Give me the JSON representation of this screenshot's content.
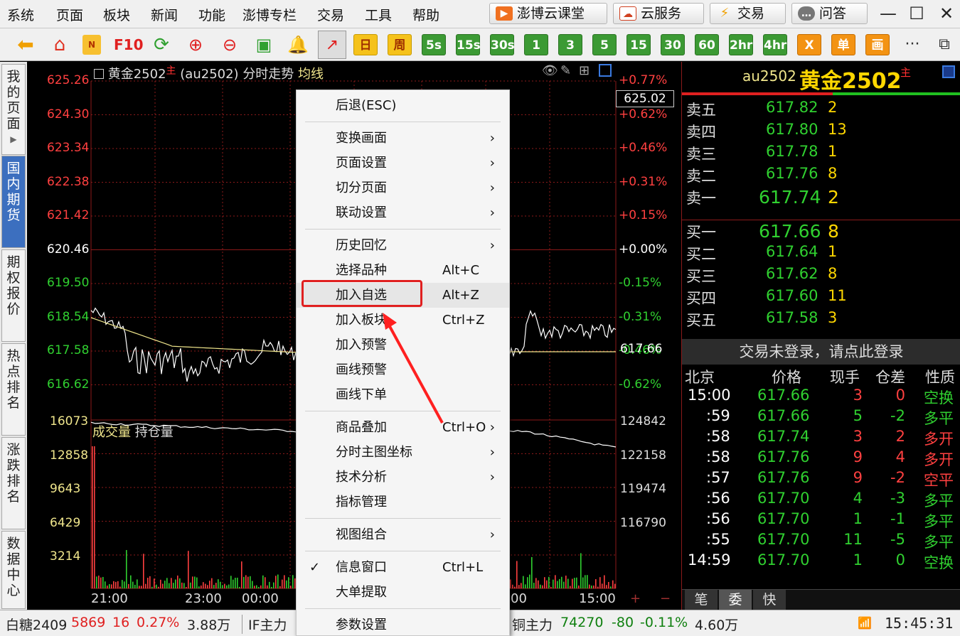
{
  "menubar": {
    "items": [
      "系统",
      "页面",
      "板块",
      "新闻",
      "功能",
      "澎博专栏",
      "交易",
      "工具",
      "帮助"
    ],
    "buttons": [
      {
        "label": "澎博云课堂",
        "icon": "classroom-icon",
        "color": "#f07020"
      },
      {
        "label": "云服务",
        "icon": "cloud-icon",
        "color": "#d04020"
      },
      {
        "label": "交易",
        "icon": "lightning-icon",
        "color": "#f0a000"
      },
      {
        "label": "问答",
        "icon": "chat-icon",
        "color": "#808080"
      }
    ]
  },
  "toolbar": {
    "periods": [
      {
        "label": "日",
        "style": "yellow"
      },
      {
        "label": "周",
        "style": "yellow"
      },
      {
        "label": "5s",
        "style": "green"
      },
      {
        "label": "15s",
        "style": "green"
      },
      {
        "label": "30s",
        "style": "green"
      },
      {
        "label": "1",
        "style": "green"
      },
      {
        "label": "3",
        "style": "green"
      },
      {
        "label": "5",
        "style": "green"
      },
      {
        "label": "15",
        "style": "green"
      },
      {
        "label": "30",
        "style": "green"
      },
      {
        "label": "60",
        "style": "green"
      },
      {
        "label": "2hr",
        "style": "green"
      },
      {
        "label": "4hr",
        "style": "green"
      },
      {
        "label": "X",
        "style": "orange"
      },
      {
        "label": "单",
        "style": "orange"
      },
      {
        "label": "画",
        "style": "orange"
      }
    ],
    "f10_label": "F10",
    "more_label": "···"
  },
  "sidebar": {
    "tabs": [
      {
        "label": "我的页面",
        "active": false
      },
      {
        "label": "国内期货",
        "active": true
      },
      {
        "label": "期权报价",
        "active": false
      },
      {
        "label": "热点排名",
        "active": false
      },
      {
        "label": "涨跌排名",
        "active": false
      },
      {
        "label": "数据中心",
        "active": false
      }
    ]
  },
  "chart": {
    "title_name": "黄金2502",
    "title_badge": "主",
    "title_code": "(au2502)",
    "title_mode": "分时走势",
    "title_avg": "均线",
    "price_labels": [
      "625.26",
      "624.30",
      "623.34",
      "622.38",
      "621.42",
      "620.46",
      "619.50",
      "618.54",
      "617.58",
      "616.62"
    ],
    "pct_labels": [
      "+0.77%",
      "+0.62%",
      "+0.46%",
      "+0.31%",
      "+0.15%",
      "+0.00%",
      "-0.15%",
      "-0.31%",
      "-0.46%",
      "-0.62%"
    ],
    "current_price_tag": "625.02",
    "last_price_tag": "617.66",
    "volume_labels": [
      "16073",
      "12858",
      "9643",
      "6429",
      "3214"
    ],
    "oi_labels": [
      "124842",
      "122158",
      "119474",
      "116790"
    ],
    "volume_legend_vol": "成交量",
    "volume_legend_oi": "持仓量",
    "time_labels": [
      "21:00",
      "23:00",
      "00:00",
      "00",
      "15:00"
    ],
    "plus": "+",
    "minus": "−",
    "colors": {
      "up": "#ff4040",
      "down": "#30d030",
      "flat": "#ffffff",
      "grid": "#8b1a1a",
      "avg": "#f0e68c"
    }
  },
  "quote": {
    "code": "au2502",
    "name": "黄金2502",
    "badge": "主",
    "asks": [
      {
        "label": "卖五",
        "price": "617.82",
        "vol": "2"
      },
      {
        "label": "卖四",
        "price": "617.80",
        "vol": "13"
      },
      {
        "label": "卖三",
        "price": "617.78",
        "vol": "1"
      },
      {
        "label": "卖二",
        "price": "617.76",
        "vol": "8"
      },
      {
        "label": "卖一",
        "price": "617.74",
        "vol": "2"
      }
    ],
    "bids": [
      {
        "label": "买一",
        "price": "617.66",
        "vol": "8"
      },
      {
        "label": "买二",
        "price": "617.64",
        "vol": "1"
      },
      {
        "label": "买三",
        "price": "617.62",
        "vol": "8"
      },
      {
        "label": "买四",
        "price": "617.60",
        "vol": "11"
      },
      {
        "label": "买五",
        "price": "617.58",
        "vol": "3"
      }
    ],
    "login_banner": "交易未登录，请点此登录",
    "tick_headers": [
      "北京",
      "价格",
      "现手",
      "仓差",
      "性质"
    ],
    "ticks": [
      {
        "time": "15:00",
        "price": "617.66",
        "hand": "3",
        "diff": "0",
        "nature": "空换",
        "hc": "up",
        "nc": "down"
      },
      {
        "time": ":59",
        "price": "617.66",
        "hand": "5",
        "diff": "-2",
        "nature": "多平",
        "hc": "down",
        "nc": "down"
      },
      {
        "time": ":58",
        "price": "617.74",
        "hand": "3",
        "diff": "2",
        "nature": "多开",
        "hc": "up",
        "nc": "up"
      },
      {
        "time": ":58",
        "price": "617.76",
        "hand": "9",
        "diff": "4",
        "nature": "多开",
        "hc": "up",
        "nc": "up"
      },
      {
        "time": ":57",
        "price": "617.76",
        "hand": "9",
        "diff": "-2",
        "nature": "空平",
        "hc": "up",
        "nc": "up"
      },
      {
        "time": ":56",
        "price": "617.70",
        "hand": "4",
        "diff": "-3",
        "nature": "多平",
        "hc": "down",
        "nc": "down"
      },
      {
        "time": ":56",
        "price": "617.70",
        "hand": "1",
        "diff": "-1",
        "nature": "多平",
        "hc": "down",
        "nc": "down"
      },
      {
        "time": ":55",
        "price": "617.70",
        "hand": "11",
        "diff": "-5",
        "nature": "多平",
        "hc": "down",
        "nc": "down"
      },
      {
        "time": "14:59",
        "price": "617.70",
        "hand": "1",
        "diff": "0",
        "nature": "空换",
        "hc": "down",
        "nc": "down"
      }
    ],
    "bottom_tabs": [
      "笔",
      "委",
      "快"
    ]
  },
  "context_menu": {
    "items": [
      {
        "label": "后退(ESC)",
        "shortcut": "",
        "submenu": false
      },
      {
        "sep": true
      },
      {
        "label": "变换画面",
        "shortcut": "",
        "submenu": true
      },
      {
        "label": "页面设置",
        "shortcut": "",
        "submenu": true
      },
      {
        "label": "切分页面",
        "shortcut": "",
        "submenu": true
      },
      {
        "label": "联动设置",
        "shortcut": "",
        "submenu": true
      },
      {
        "sep": true
      },
      {
        "label": "历史回忆",
        "shortcut": "",
        "submenu": true
      },
      {
        "label": "选择品种",
        "shortcut": "Alt+C",
        "submenu": false
      },
      {
        "label": "加入自选",
        "shortcut": "Alt+Z",
        "submenu": false,
        "highlight": true
      },
      {
        "label": "加入板块",
        "shortcut": "Ctrl+Z",
        "submenu": false
      },
      {
        "label": "加入预警",
        "shortcut": "",
        "submenu": false
      },
      {
        "label": "画线预警",
        "shortcut": "",
        "submenu": false
      },
      {
        "label": "画线下单",
        "shortcut": "",
        "submenu": false
      },
      {
        "sep": true
      },
      {
        "label": "商品叠加",
        "shortcut": "Ctrl+O",
        "submenu": true
      },
      {
        "label": "分时主图坐标",
        "shortcut": "",
        "submenu": true
      },
      {
        "label": "技术分析",
        "shortcut": "",
        "submenu": true
      },
      {
        "label": "指标管理",
        "shortcut": "",
        "submenu": false
      },
      {
        "sep": true
      },
      {
        "label": "视图组合",
        "shortcut": "",
        "submenu": true
      },
      {
        "sep": true
      },
      {
        "label": "信息窗口",
        "shortcut": "Ctrl+L",
        "submenu": false,
        "checked": true
      },
      {
        "label": "大单提取",
        "shortcut": "",
        "submenu": false
      },
      {
        "sep": true
      },
      {
        "label": "参数设置",
        "shortcut": "",
        "submenu": false
      }
    ]
  },
  "statusbar": {
    "left_name": "白糖2409",
    "left_price": "5869",
    "left_change": "16",
    "left_pct": "0.27%",
    "left_vol": "3.88万",
    "if_label": "IF主力",
    "copper_name": "铜主力",
    "copper_price": "74270",
    "copper_change": "-80",
    "copper_pct": "-0.11%",
    "copper_vol": "4.60万",
    "clock": "15:45:31"
  }
}
